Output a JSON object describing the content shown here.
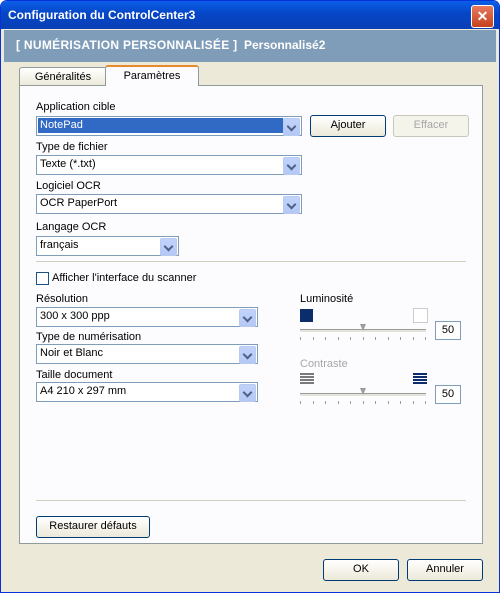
{
  "window": {
    "title": "Configuration du ControlCenter3",
    "close_glyph": "✕"
  },
  "header": {
    "main": "[ NUMÉRISATION PERSONNALISÉE ]",
    "sub": "Personnalisé2"
  },
  "tabs": [
    {
      "label": "Généralités"
    },
    {
      "label": "Paramètres"
    }
  ],
  "settings": {
    "target_app": {
      "label": "Application cible",
      "value": "NotePad",
      "add_button": "Ajouter",
      "delete_button": "Effacer"
    },
    "file_type": {
      "label": "Type de fichier",
      "value": "Texte (*.txt)"
    },
    "ocr_software": {
      "label": "Logiciel OCR",
      "value": "OCR PaperPort"
    },
    "ocr_language": {
      "label": "Langage OCR",
      "value": "français"
    },
    "show_scanner_ui": {
      "label": "Afficher l'interface du scanner",
      "checked": false
    },
    "resolution": {
      "label": "Résolution",
      "value": "300 x 300 ppp"
    },
    "scan_type": {
      "label": "Type de numérisation",
      "value": "Noir et Blanc"
    },
    "doc_size": {
      "label": "Taille document",
      "value": "A4 210 x 297 mm"
    },
    "brightness": {
      "label": "Luminosité",
      "value": "50",
      "level": 0.5
    },
    "contrast": {
      "label": "Contraste",
      "value": "50",
      "level": 0.5
    },
    "restore_button": "Restaurer défauts"
  },
  "footer": {
    "ok": "OK",
    "cancel": "Annuler"
  }
}
